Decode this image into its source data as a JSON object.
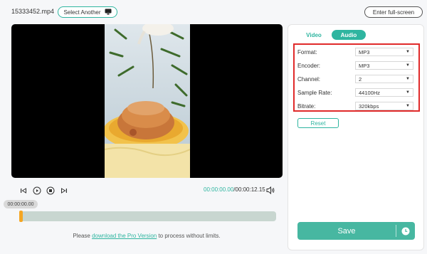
{
  "header": {
    "filename": "15333452.mp4",
    "select_another_label": "Select Another",
    "full_screen_label": "Enter full-screen"
  },
  "player": {
    "current_time": "00:00:00.00",
    "total_time": "/00:00:12.15",
    "bubble_time": "00:00:00.00",
    "progress": 0
  },
  "notice": {
    "prefix": "Please ",
    "link": "download the Pro Version",
    "suffix": " to process without limits."
  },
  "tabs": {
    "video": "Video",
    "audio": "Audio"
  },
  "settings": {
    "format_label": "Format:",
    "format_value": "MP3",
    "encoder_label": "Encoder:",
    "encoder_value": "MP3",
    "channel_label": "Channel:",
    "channel_value": "2",
    "sample_rate_label": "Sample Rate:",
    "sample_rate_value": "44100Hz",
    "bitrate_label": "Bitrate:",
    "bitrate_value": "320kbps"
  },
  "actions": {
    "reset_label": "Reset",
    "save_label": "Save"
  },
  "colors": {
    "accent": "#2fb5a0",
    "highlight_border": "#e02a2a",
    "playhead": "#f5a623"
  },
  "icons": {
    "monitor": "monitor-icon",
    "prev_frame": "prev-frame-icon",
    "play": "play-icon",
    "stop": "stop-icon",
    "next_frame": "next-frame-icon",
    "volume": "volume-icon",
    "clock": "clock-icon"
  }
}
